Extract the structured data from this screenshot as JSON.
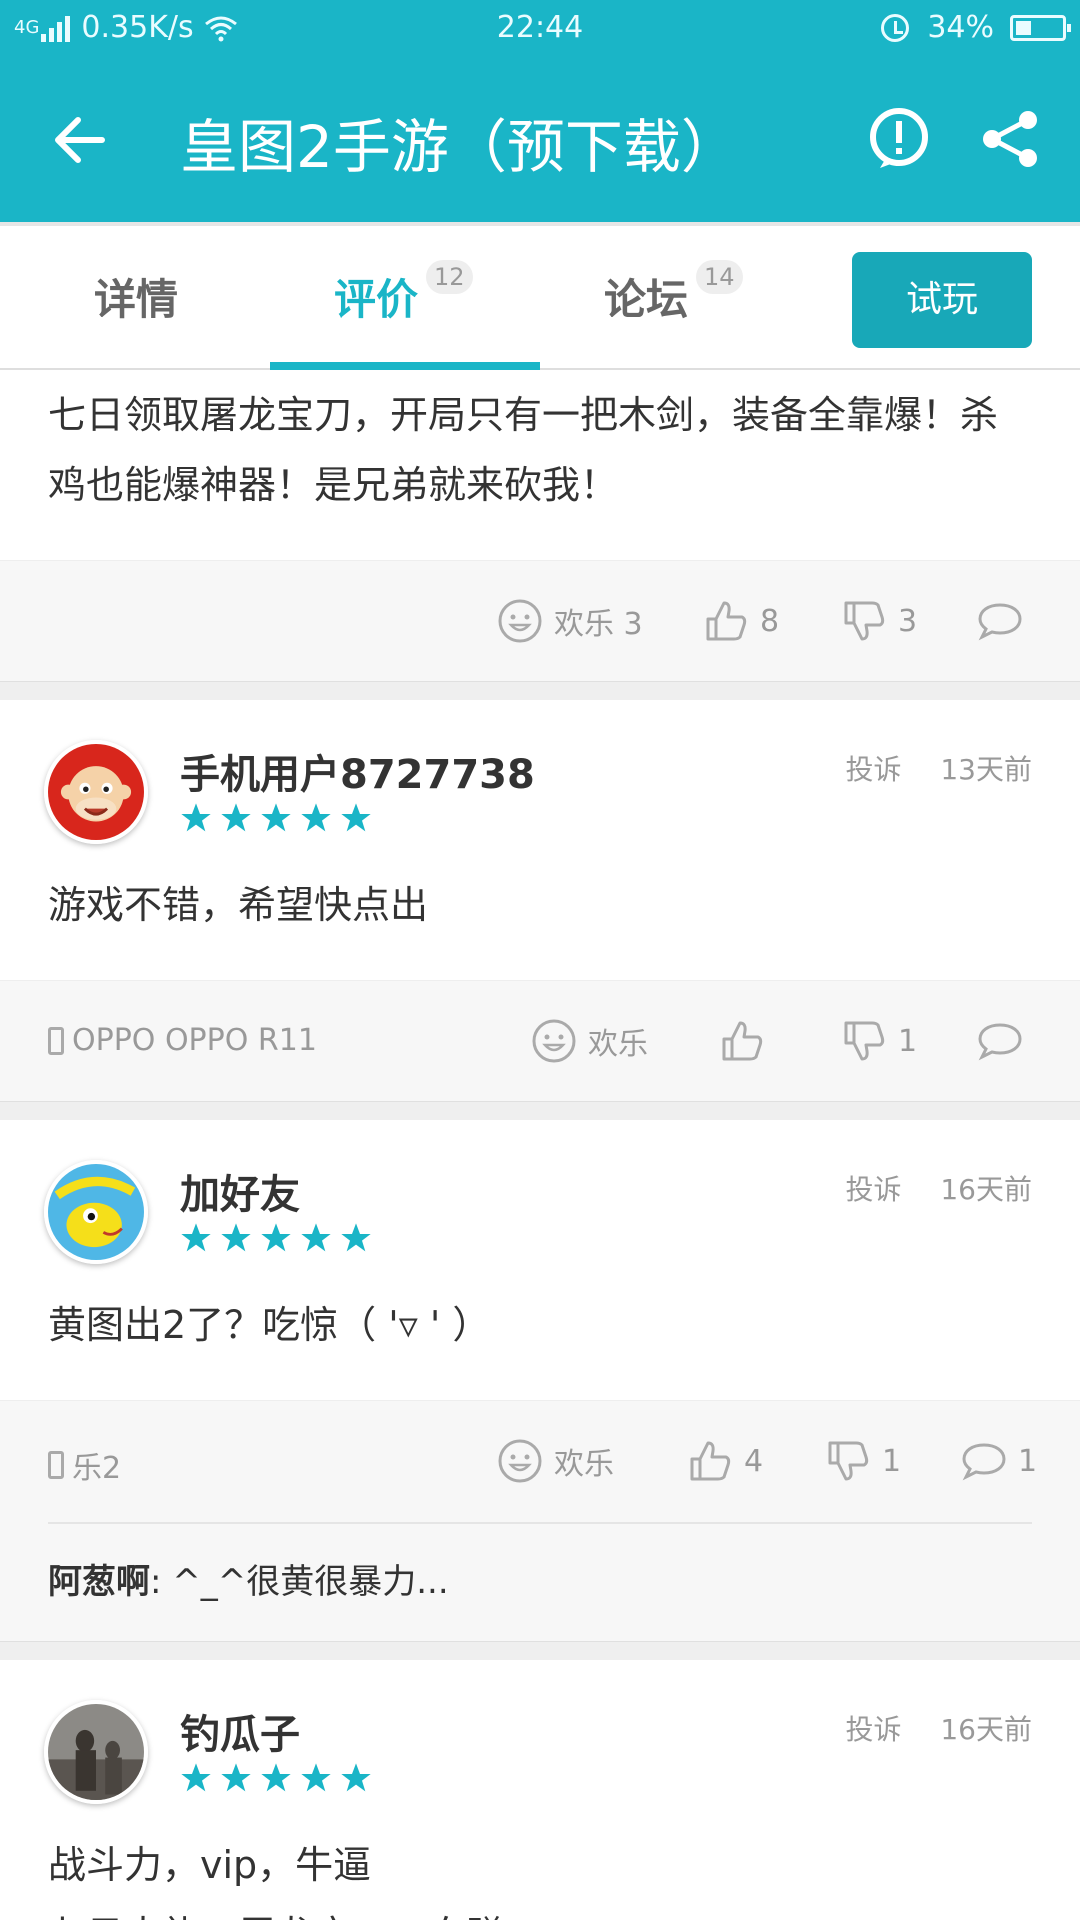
{
  "status": {
    "network": "4G",
    "speed": "0.35K/s",
    "time": "22:44",
    "battery": "34%"
  },
  "appbar": {
    "title": "皇图2手游（预下载）"
  },
  "tabs": [
    {
      "label": "详情",
      "count": ""
    },
    {
      "label": "评价",
      "count": "12"
    },
    {
      "label": "论坛",
      "count": "14"
    }
  ],
  "try_button": "试玩",
  "reviews": [
    {
      "text": "七日领取屠龙宝刀，开局只有一把木剑，装备全靠爆！杀鸡也能爆神器！是兄弟就来砍我！",
      "fun": "欢乐 3",
      "likes": "8",
      "dislikes": "3",
      "comments": ""
    },
    {
      "user": "手机用户8727738",
      "report": "投诉",
      "time": "13天前",
      "text": "游戏不错，希望快点出",
      "device": "OPPO OPPO R11",
      "fun": "欢乐",
      "likes": "",
      "dislikes": "1",
      "comments": ""
    },
    {
      "user": "加好友",
      "report": "投诉",
      "time": "16天前",
      "text": "黄图出2了？吃惊（ '▿ ' ）",
      "device": "乐2",
      "fun": "欢乐",
      "likes": "4",
      "dislikes": "1",
      "comments": "1",
      "reply_user": "阿葱啊",
      "reply_text": ": ^_^很黄很暴力..."
    },
    {
      "user": "钓瓜子",
      "report": "投诉",
      "time": "16天前",
      "text_line1": "战斗力，vip，牛逼",
      "text_line2": "七日大礼，屠龙宝刀，血赚"
    }
  ],
  "colors": {
    "accent": "#1ab5c7",
    "star": "#1ab5c7"
  }
}
